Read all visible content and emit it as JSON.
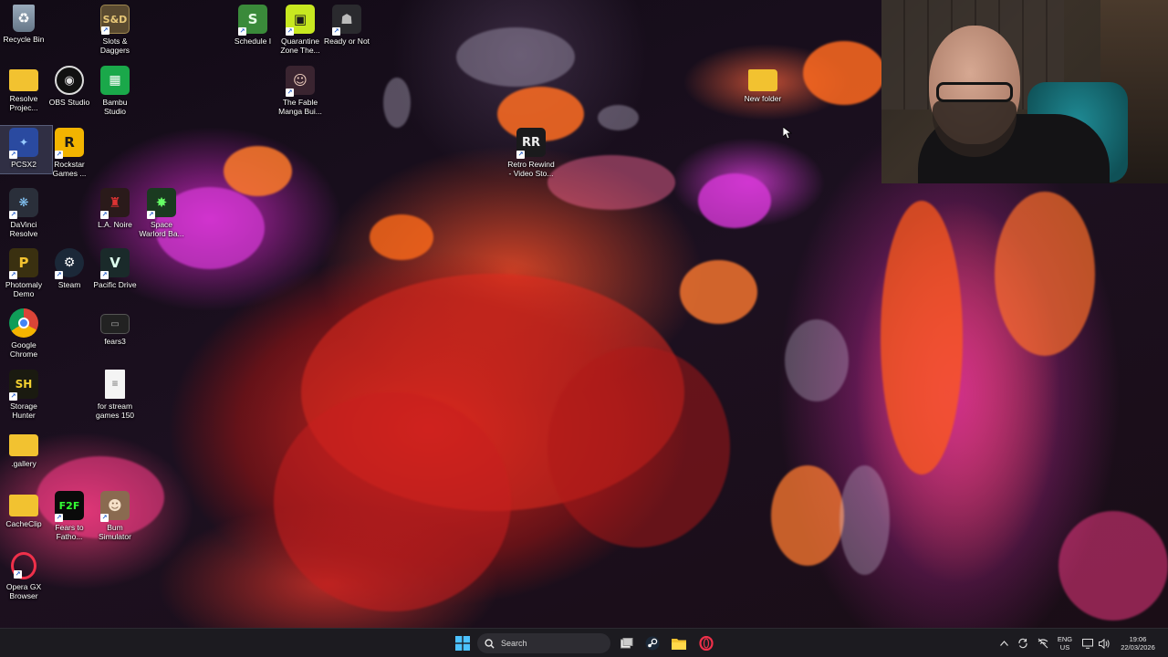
{
  "desktop": {
    "icons": [
      {
        "id": "recycle-bin",
        "label": "Recycle Bin",
        "icon": "recycle-bin-icon"
      },
      {
        "id": "slots-daggers",
        "label": "Slots &\nDaggers",
        "icon": "slots-daggers-icon"
      },
      {
        "id": "schedule-i",
        "label": "Schedule I",
        "icon": "schedule-i-icon"
      },
      {
        "id": "quarantine-zone",
        "label": "Quarantine\nZone The...",
        "icon": "quarantine-zone-icon"
      },
      {
        "id": "ready-or-not",
        "label": "Ready or Not",
        "icon": "ready-or-not-icon"
      },
      {
        "id": "resolve-projects",
        "label": "Resolve\nProjec...",
        "icon": "folder-icon"
      },
      {
        "id": "obs-studio",
        "label": "OBS Studio",
        "icon": "obs-icon"
      },
      {
        "id": "bambu-studio",
        "label": "Bambu\nStudio",
        "icon": "bambu-icon"
      },
      {
        "id": "fable-manga",
        "label": "The Fable\nManga Bui...",
        "icon": "fable-icon"
      },
      {
        "id": "new-folder",
        "label": "New folder",
        "icon": "folder-icon"
      },
      {
        "id": "pcsx2",
        "label": "PCSX2",
        "icon": "pcsx2-icon"
      },
      {
        "id": "rockstar",
        "label": "Rockstar\nGames ...",
        "icon": "rockstar-icon"
      },
      {
        "id": "retro-rewind",
        "label": "Retro Rewind\n- Video Sto...",
        "icon": "retro-rewind-icon"
      },
      {
        "id": "davinci",
        "label": "DaVinci\nResolve",
        "icon": "davinci-icon"
      },
      {
        "id": "la-noire",
        "label": "L.A. Noire",
        "icon": "la-noire-icon"
      },
      {
        "id": "space-warlord",
        "label": "Space\nWarlord Ba...",
        "icon": "space-warlord-icon"
      },
      {
        "id": "photomaly",
        "label": "Photomaly\nDemo",
        "icon": "photomaly-icon"
      },
      {
        "id": "steam",
        "label": "Steam",
        "icon": "steam-icon"
      },
      {
        "id": "pacific-drive",
        "label": "Pacific Drive",
        "icon": "pacific-drive-icon"
      },
      {
        "id": "chrome",
        "label": "Google\nChrome",
        "icon": "chrome-icon"
      },
      {
        "id": "fears3",
        "label": "fears3",
        "icon": "film-icon"
      },
      {
        "id": "storage-hunter",
        "label": "Storage\nHunter",
        "icon": "storage-hunter-icon"
      },
      {
        "id": "stream-games",
        "label": "for stream\ngames 150",
        "icon": "text-file-icon"
      },
      {
        "id": "gallery",
        "label": ".gallery",
        "icon": "folder-icon"
      },
      {
        "id": "cacheclip",
        "label": "CacheClip",
        "icon": "folder-icon"
      },
      {
        "id": "fears-to-fathom",
        "label": "Fears to\nFatho...",
        "icon": "f2f-icon"
      },
      {
        "id": "bum-simulator",
        "label": "Bum\nSimulator",
        "icon": "bum-simulator-icon"
      },
      {
        "id": "opera-gx",
        "label": "Opera GX\nBrowser",
        "icon": "opera-gx-icon"
      }
    ]
  },
  "taskbar": {
    "search_label": "Search",
    "pinned": [
      "start-icon",
      "task-view-icon",
      "steam-icon",
      "file-explorer-icon",
      "opera-gx-icon"
    ],
    "tray": {
      "lang_top": "ENG",
      "lang_bottom": "US",
      "time": "19:06",
      "date": "22/03/2026"
    }
  },
  "colors": {
    "taskbar_bg": "#1c1b20",
    "accent_orange": "#ff5a1e",
    "accent_magenta": "#c81ec8"
  }
}
